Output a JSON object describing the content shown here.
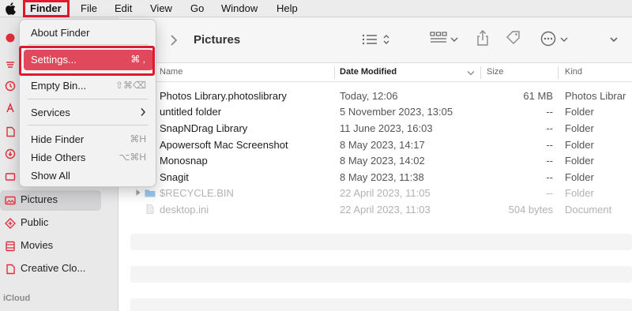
{
  "menubar": {
    "apple_icon": "apple-logo-icon",
    "items": [
      "Finder",
      "File",
      "Edit",
      "View",
      "Go",
      "Window",
      "Help"
    ]
  },
  "finder_menu": {
    "about": "About Finder",
    "settings": {
      "label": "Settings...",
      "shortcut": "⌘ ,"
    },
    "empty_bin": {
      "label": "Empty Bin...",
      "shortcut": "⇧⌘⌫"
    },
    "services": {
      "label": "Services",
      "icon": "chevron-right-icon"
    },
    "hide_finder": {
      "label": "Hide Finder",
      "shortcut": "⌘H"
    },
    "hide_others": {
      "label": "Hide Others",
      "shortcut": "⌥⌘H"
    },
    "show_all": "Show All"
  },
  "sidebar": {
    "items": [
      {
        "label": "Pictures",
        "icon": "pictures-icon",
        "selected": true
      },
      {
        "label": "Public",
        "icon": "public-icon"
      },
      {
        "label": "Movies",
        "icon": "movies-icon"
      },
      {
        "label": "Creative Clo...",
        "icon": "document-icon"
      }
    ],
    "section_icloud": "iCloud"
  },
  "toolbar": {
    "title": "Pictures",
    "icons": [
      "forward-icon",
      "list-view-icon",
      "sort-icon",
      "group-icon",
      "share-icon",
      "tag-icon",
      "more-actions-icon",
      "chevron-down-icon"
    ]
  },
  "columns": {
    "name": "Name",
    "date": "Date Modified",
    "size": "Size",
    "kind": "Kind"
  },
  "files": [
    {
      "name": "Photos Library.photoslibrary",
      "date": "Today, 12:06",
      "size": "61 MB",
      "kind": "Photos Librar",
      "dim": false
    },
    {
      "name": "untitled folder",
      "date": "5 November 2023, 13:05",
      "size": "--",
      "kind": "Folder",
      "dim": false
    },
    {
      "name": "SnapNDrag Library",
      "date": "11 June 2023, 16:03",
      "size": "--",
      "kind": "Folder",
      "dim": false
    },
    {
      "name": "Apowersoft Mac Screenshot",
      "date": "8 May 2023, 14:17",
      "size": "--",
      "kind": "Folder",
      "dim": false
    },
    {
      "name": "Monosnap",
      "date": "8 May 2023, 14:02",
      "size": "--",
      "kind": "Folder",
      "dim": false
    },
    {
      "name": "Snagit",
      "date": "8 May 2023, 11:38",
      "size": "--",
      "kind": "Folder",
      "dim": false
    },
    {
      "name": "$RECYCLE.BIN",
      "date": "22 April 2023, 11:05",
      "size": "--",
      "kind": "Folder",
      "dim": true
    },
    {
      "name": "desktop.ini",
      "date": "22 April 2023, 11:03",
      "size": "504 bytes",
      "kind": "Document",
      "dim": true
    }
  ],
  "colors": {
    "accent": "#e0495c",
    "highlight_box": "#e0192b",
    "folder": "#5aa7e8"
  }
}
